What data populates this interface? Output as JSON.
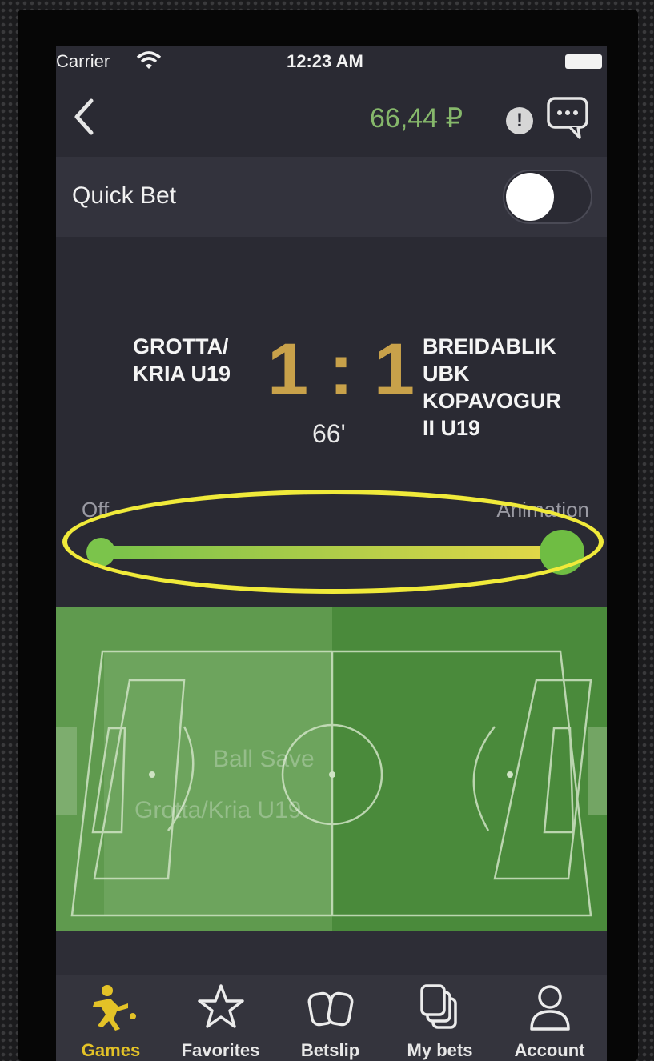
{
  "status_bar": {
    "carrier": "Carrier",
    "time": "12:23 AM"
  },
  "header": {
    "balance": "66,44 ₽",
    "alert_icon": "!"
  },
  "quick_bet": {
    "label": "Quick Bet",
    "enabled": false
  },
  "match": {
    "home_team": "GROTTA/\nKRIA U19",
    "away_team": "BREIDABLIK\nUBK\nKOPAVOGUR\nII U19",
    "score": "1 : 1",
    "minute": "66'"
  },
  "visualization_slider": {
    "left_label": "Off",
    "right_label": "Animation",
    "level": 1.0
  },
  "pitch": {
    "event": "Ball Save",
    "team": "Grotta/Kria U19"
  },
  "tabs": [
    {
      "label": "Games",
      "icon": "soccer-player-icon",
      "active": true
    },
    {
      "label": "Favorites",
      "icon": "star-icon",
      "active": false
    },
    {
      "label": "Betslip",
      "icon": "betslip-icon",
      "active": false
    },
    {
      "label": "My bets",
      "icon": "my-bets-icon",
      "active": false
    },
    {
      "label": "Account",
      "icon": "person-icon",
      "active": false
    }
  ],
  "colors": {
    "balance": "#86b86b",
    "score": "#c8a14a",
    "active_tab": "#e3c227",
    "highlight": "#f0ea3a",
    "pitch": "#4f8f40"
  }
}
